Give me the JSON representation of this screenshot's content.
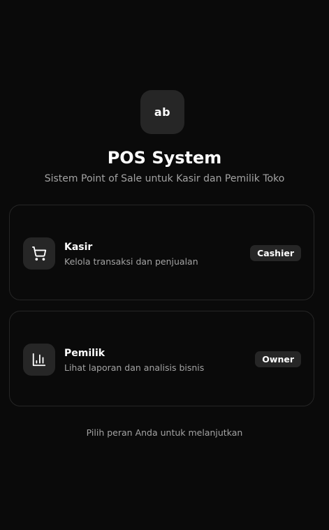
{
  "header": {
    "logo_text": "ab",
    "title": "POS System",
    "subtitle": "Sistem Point of Sale untuk Kasir dan Pemilik Toko"
  },
  "roles": [
    {
      "title": "Kasir",
      "description": "Kelola transaksi dan penjualan",
      "badge": "Cashier",
      "icon": "shopping-cart-icon"
    },
    {
      "title": "Pemilik",
      "description": "Lihat laporan dan analisis bisnis",
      "badge": "Owner",
      "icon": "bar-chart-icon"
    }
  ],
  "footer": {
    "hint": "Pilih peran Anda untuk melanjutkan"
  },
  "colors": {
    "background": "#0a0a0a",
    "card_border": "#262626",
    "surface": "#262626",
    "muted_text": "#a3a3a3",
    "text": "#ffffff"
  }
}
